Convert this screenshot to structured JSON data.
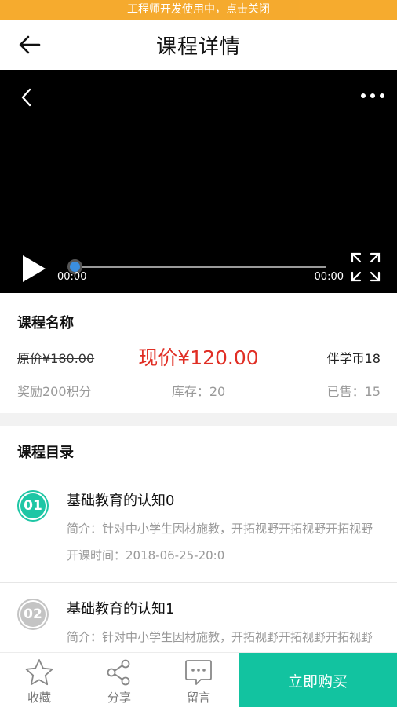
{
  "dev_banner": "工程师开发使用中，点击关闭",
  "header": {
    "title": "课程详情"
  },
  "video": {
    "current_time": "00:00",
    "total_time": "00:00",
    "progress": 0
  },
  "course": {
    "name": "课程名称",
    "original_price": "原价¥180.00",
    "current_price": "现价¥120.00",
    "coin": "伴学币18",
    "reward": "奖励200积分",
    "stock": "库存：20",
    "sold": "已售：15"
  },
  "catalog": {
    "title": "课程目录",
    "lessons": [
      {
        "number": "01",
        "name": "基础教育的认知0",
        "desc": "简介：针对中小学生因材施教，开拓视野开拓视野开拓视野",
        "time": "开课时间：2018-06-25-20:0"
      },
      {
        "number": "02",
        "name": "基础教育的认知1",
        "desc": "简介：针对中小学生因材施教，开拓视野开拓视野开拓视野",
        "time": ""
      }
    ]
  },
  "bottom_bar": {
    "favorite": "收藏",
    "share": "分享",
    "message": "留言",
    "buy": "立即购买"
  },
  "colors": {
    "accent": "#12c3a0",
    "price": "#e02e24",
    "banner": "#f5a623"
  }
}
